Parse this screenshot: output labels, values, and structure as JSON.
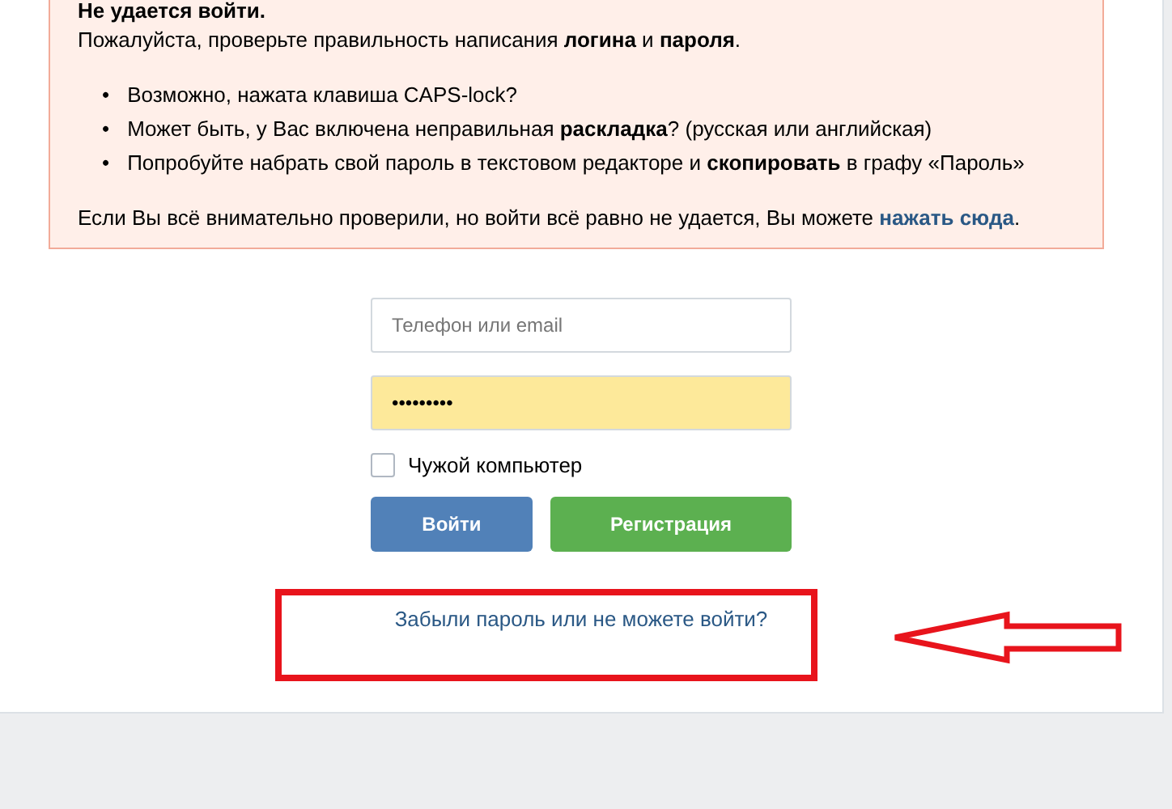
{
  "alert": {
    "title": "Не удается войти.",
    "message": "Пожалуйста, проверьте правильность написания **логина** и **пароля**.",
    "tips": [
      {
        "bullet": "•",
        "text": "Возможно, нажата клавиша CAPS-lock?"
      },
      {
        "bullet": "•",
        "text": "Может быть, у Вас включена неправильная **раскладка**? (русская или английская)"
      },
      {
        "bullet": "•",
        "text": "Попробуйте набрать свой пароль в текстовом редакторе и **скопировать** в графу «Пароль»"
      }
    ],
    "footer": {
      "text": "Если Вы всё внимательно проверили, но войти всё равно не удается, Вы можете",
      "link": "нажать сюда",
      "end": "."
    }
  },
  "form": {
    "login": {
      "placeholder": "Телефон или email"
    },
    "password": {
      "value": "•••••••••",
      "autofilled": true
    },
    "remember": {
      "label": "Чужой компьютер",
      "checked": false
    },
    "buttons": [
      {
        "label": "Войти",
        "kind": "primary"
      },
      {
        "label": "Регистрация",
        "kind": "secondary"
      }
    ],
    "forgot_link": "Забыли пароль или не можете войти?"
  }
}
